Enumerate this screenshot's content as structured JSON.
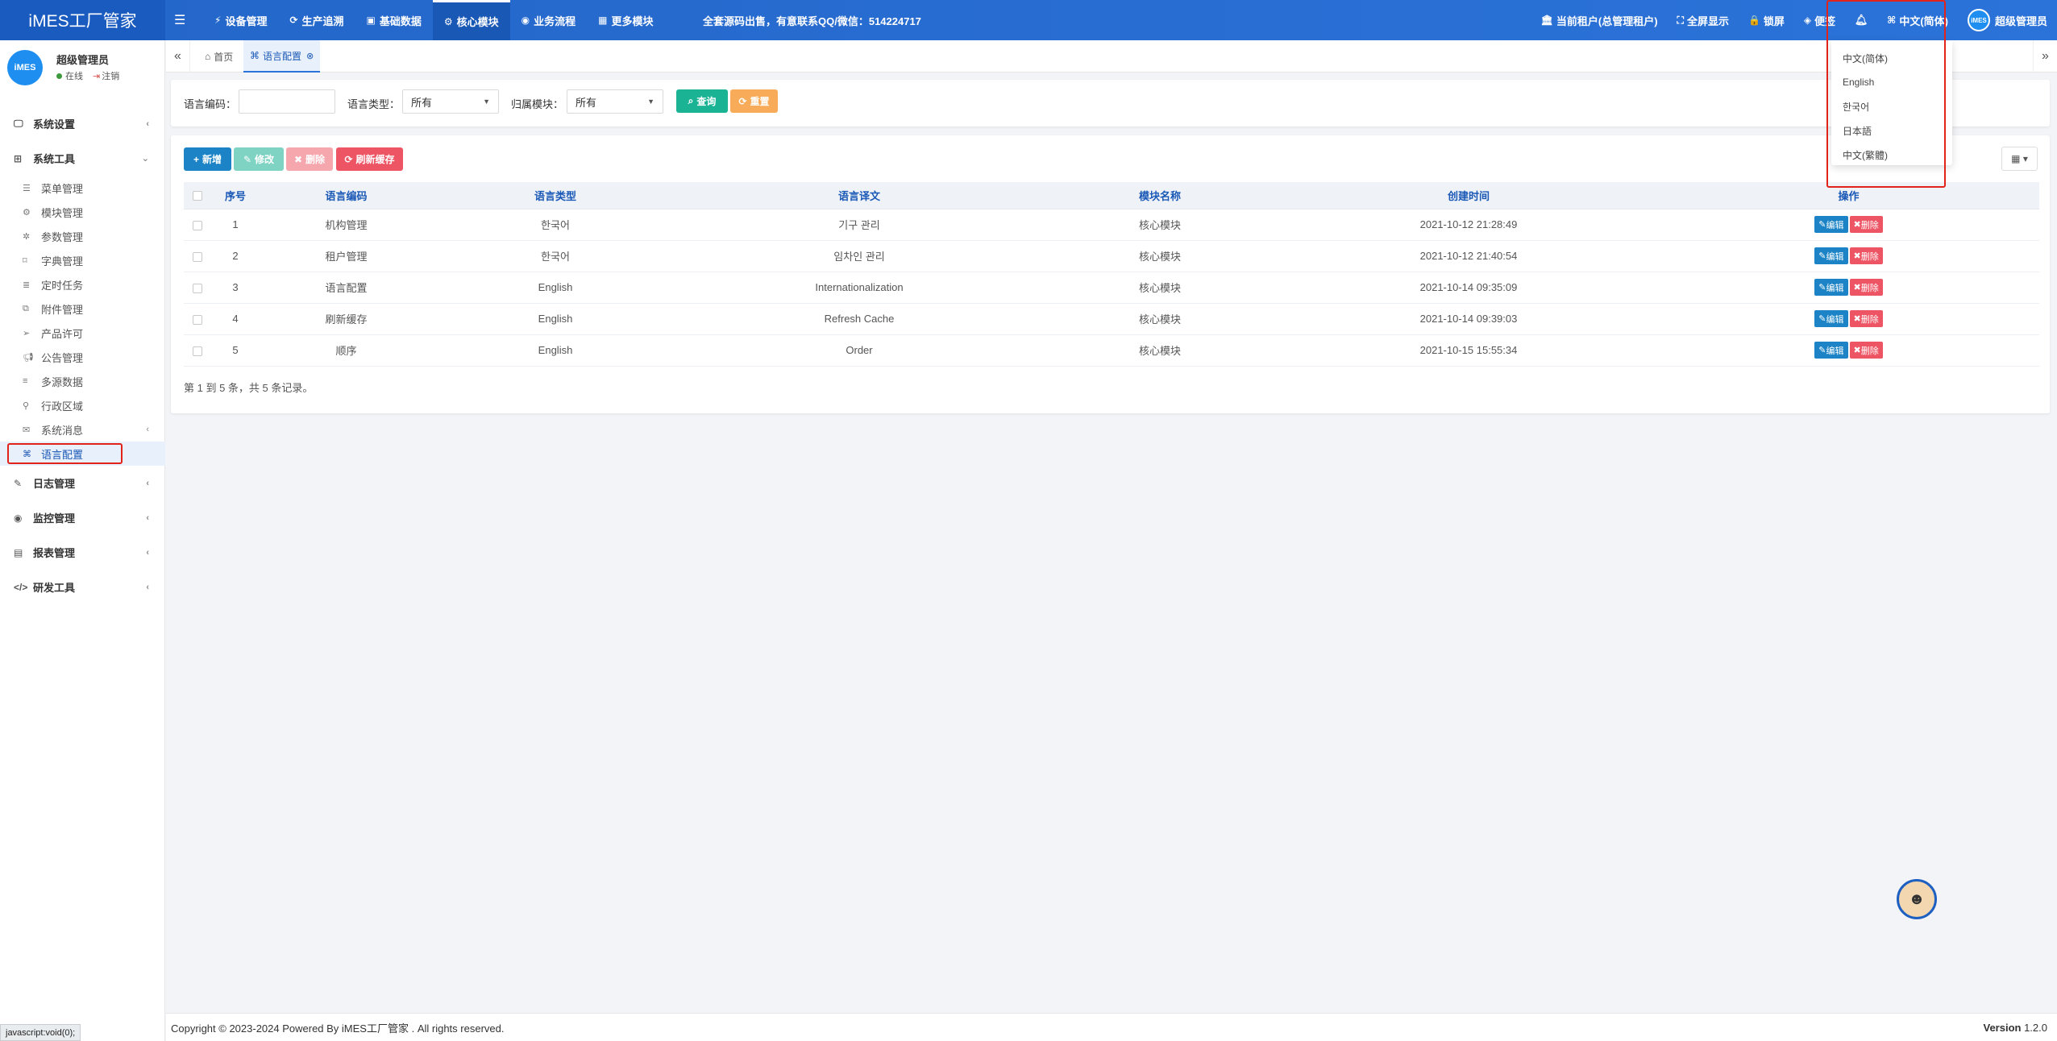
{
  "header": {
    "logo": "iMES工厂管家",
    "nav": [
      {
        "label": "设备管理",
        "icon": "wrench-icon",
        "active": false
      },
      {
        "label": "生产追溯",
        "icon": "refresh-icon",
        "active": false
      },
      {
        "label": "基础数据",
        "icon": "id-card-icon",
        "active": false
      },
      {
        "label": "核心模块",
        "icon": "gear-icon",
        "active": true
      },
      {
        "label": "业务流程",
        "icon": "eye-icon",
        "active": false
      },
      {
        "label": "更多模块",
        "icon": "grid-icon",
        "active": false
      }
    ],
    "notice": "全套源码出售，有意联系QQ/微信：514224717",
    "right": {
      "tenant": "当前租户(总管理租户)",
      "fullscreen": "全屏显示",
      "lock": "锁屏",
      "note": "便签",
      "language": "中文(简体)",
      "user": "超级管理员",
      "mini_logo": "iMES"
    }
  },
  "sidebar": {
    "avatar_text": "iMES",
    "username": "超级管理员",
    "online": "在线",
    "logout": "注销",
    "groups": [
      {
        "label": "系统设置",
        "icon": "monitor-icon"
      },
      {
        "label": "系统工具",
        "icon": "windows-icon"
      },
      {
        "label": "日志管理",
        "icon": "edit-icon"
      },
      {
        "label": "监控管理",
        "icon": "eye-icon"
      },
      {
        "label": "报表管理",
        "icon": "report-icon"
      },
      {
        "label": "研发工具",
        "icon": "code-icon"
      }
    ],
    "tools_items": [
      {
        "label": "菜单管理",
        "icon": "list-icon"
      },
      {
        "label": "模块管理",
        "icon": "cogs-icon"
      },
      {
        "label": "参数管理",
        "icon": "gear-icon"
      },
      {
        "label": "字典管理",
        "icon": "bookmark-icon"
      },
      {
        "label": "定时任务",
        "icon": "tasks-icon"
      },
      {
        "label": "附件管理",
        "icon": "copy-icon"
      },
      {
        "label": "产品许可",
        "icon": "paper-plane-icon"
      },
      {
        "label": "公告管理",
        "icon": "bullhorn-icon"
      },
      {
        "label": "多源数据",
        "icon": "database-icon"
      },
      {
        "label": "行政区域",
        "icon": "map-marker-icon"
      },
      {
        "label": "系统消息",
        "icon": "envelope-icon"
      },
      {
        "label": "语言配置",
        "icon": "language-icon"
      }
    ]
  },
  "tabs": {
    "home": "首页",
    "current": "语言配置"
  },
  "search": {
    "code_label": "语言编码：",
    "code_value": "",
    "type_label": "语言类型：",
    "type_value": "所有",
    "module_label": "归属模块：",
    "module_value": "所有",
    "query_btn": "查询",
    "reset_btn": "重置"
  },
  "toolbar": {
    "add": "新增",
    "edit": "修改",
    "delete": "删除",
    "refresh": "刷新缓存"
  },
  "table": {
    "columns": [
      "序号",
      "语言编码",
      "语言类型",
      "语言译文",
      "模块名称",
      "创建时间",
      "操作"
    ],
    "rows": [
      {
        "no": "1",
        "code": "机构管理",
        "type": "한국어",
        "text": "기구 관리",
        "module": "核心模块",
        "time": "2021-10-12 21:28:49"
      },
      {
        "no": "2",
        "code": "租户管理",
        "type": "한국어",
        "text": "임차인 관리",
        "module": "核心模块",
        "time": "2021-10-12 21:40:54"
      },
      {
        "no": "3",
        "code": "语言配置",
        "type": "English",
        "text": "Internationalization",
        "module": "核心模块",
        "time": "2021-10-14 09:35:09"
      },
      {
        "no": "4",
        "code": "刷新缓存",
        "type": "English",
        "text": "Refresh Cache",
        "module": "核心模块",
        "time": "2021-10-14 09:39:03"
      },
      {
        "no": "5",
        "code": "顺序",
        "type": "English",
        "text": "Order",
        "module": "核心模块",
        "time": "2021-10-15 15:55:34"
      }
    ],
    "op_edit": "编辑",
    "op_delete": "删除",
    "pager": "第 1 到 5 条，共 5 条记录。"
  },
  "language_dropdown": [
    "中文(简体)",
    "English",
    "한국어",
    "日本語",
    "中文(繁體)"
  ],
  "footer": {
    "copyright": "Copyright © 2023-2024 Powered By iMES工厂管家 . All rights reserved.",
    "version_label": "Version",
    "version": "1.2.0"
  },
  "status_url": "javascript:void(0);",
  "colors": {
    "header": "#2466c9",
    "primary": "#1c84c6",
    "success": "#1ab394",
    "warning": "#f8ac59",
    "danger": "#ed5565",
    "highlight_outline": "#e2231a"
  }
}
